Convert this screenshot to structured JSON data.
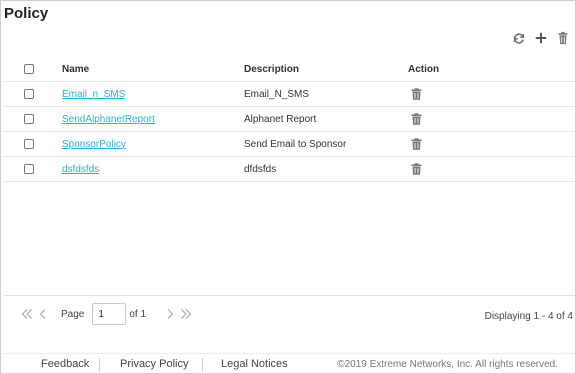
{
  "page": {
    "title": "Policy"
  },
  "toolbar": {
    "refresh": "refresh-icon",
    "add": "plus-icon",
    "delete": "trash-icon"
  },
  "table": {
    "columns": [
      "Name",
      "Description",
      "Action"
    ],
    "rows": [
      {
        "name": "Email_n_SMS",
        "description": "Email_N_SMS"
      },
      {
        "name": "SendAlphanetReport",
        "description": "Alphanet Report"
      },
      {
        "name": "SponsorPolicy",
        "description": "Send Email to Sponsor"
      },
      {
        "name": "dsfdsfds",
        "description": "dfdsfds"
      }
    ]
  },
  "pager": {
    "page_label": "Page",
    "page_value": "1",
    "of_label": "of 1",
    "displaying": "Displaying 1 - 4 of 4"
  },
  "footer": {
    "feedback": "Feedback",
    "privacy": "Privacy Policy",
    "legal": "Legal Notices",
    "copyright": "©2019 Extreme Networks, Inc. All rights reserved."
  },
  "colors": {
    "link": "#21b6d3",
    "border": "#cfcfcf",
    "text": "#333333"
  }
}
